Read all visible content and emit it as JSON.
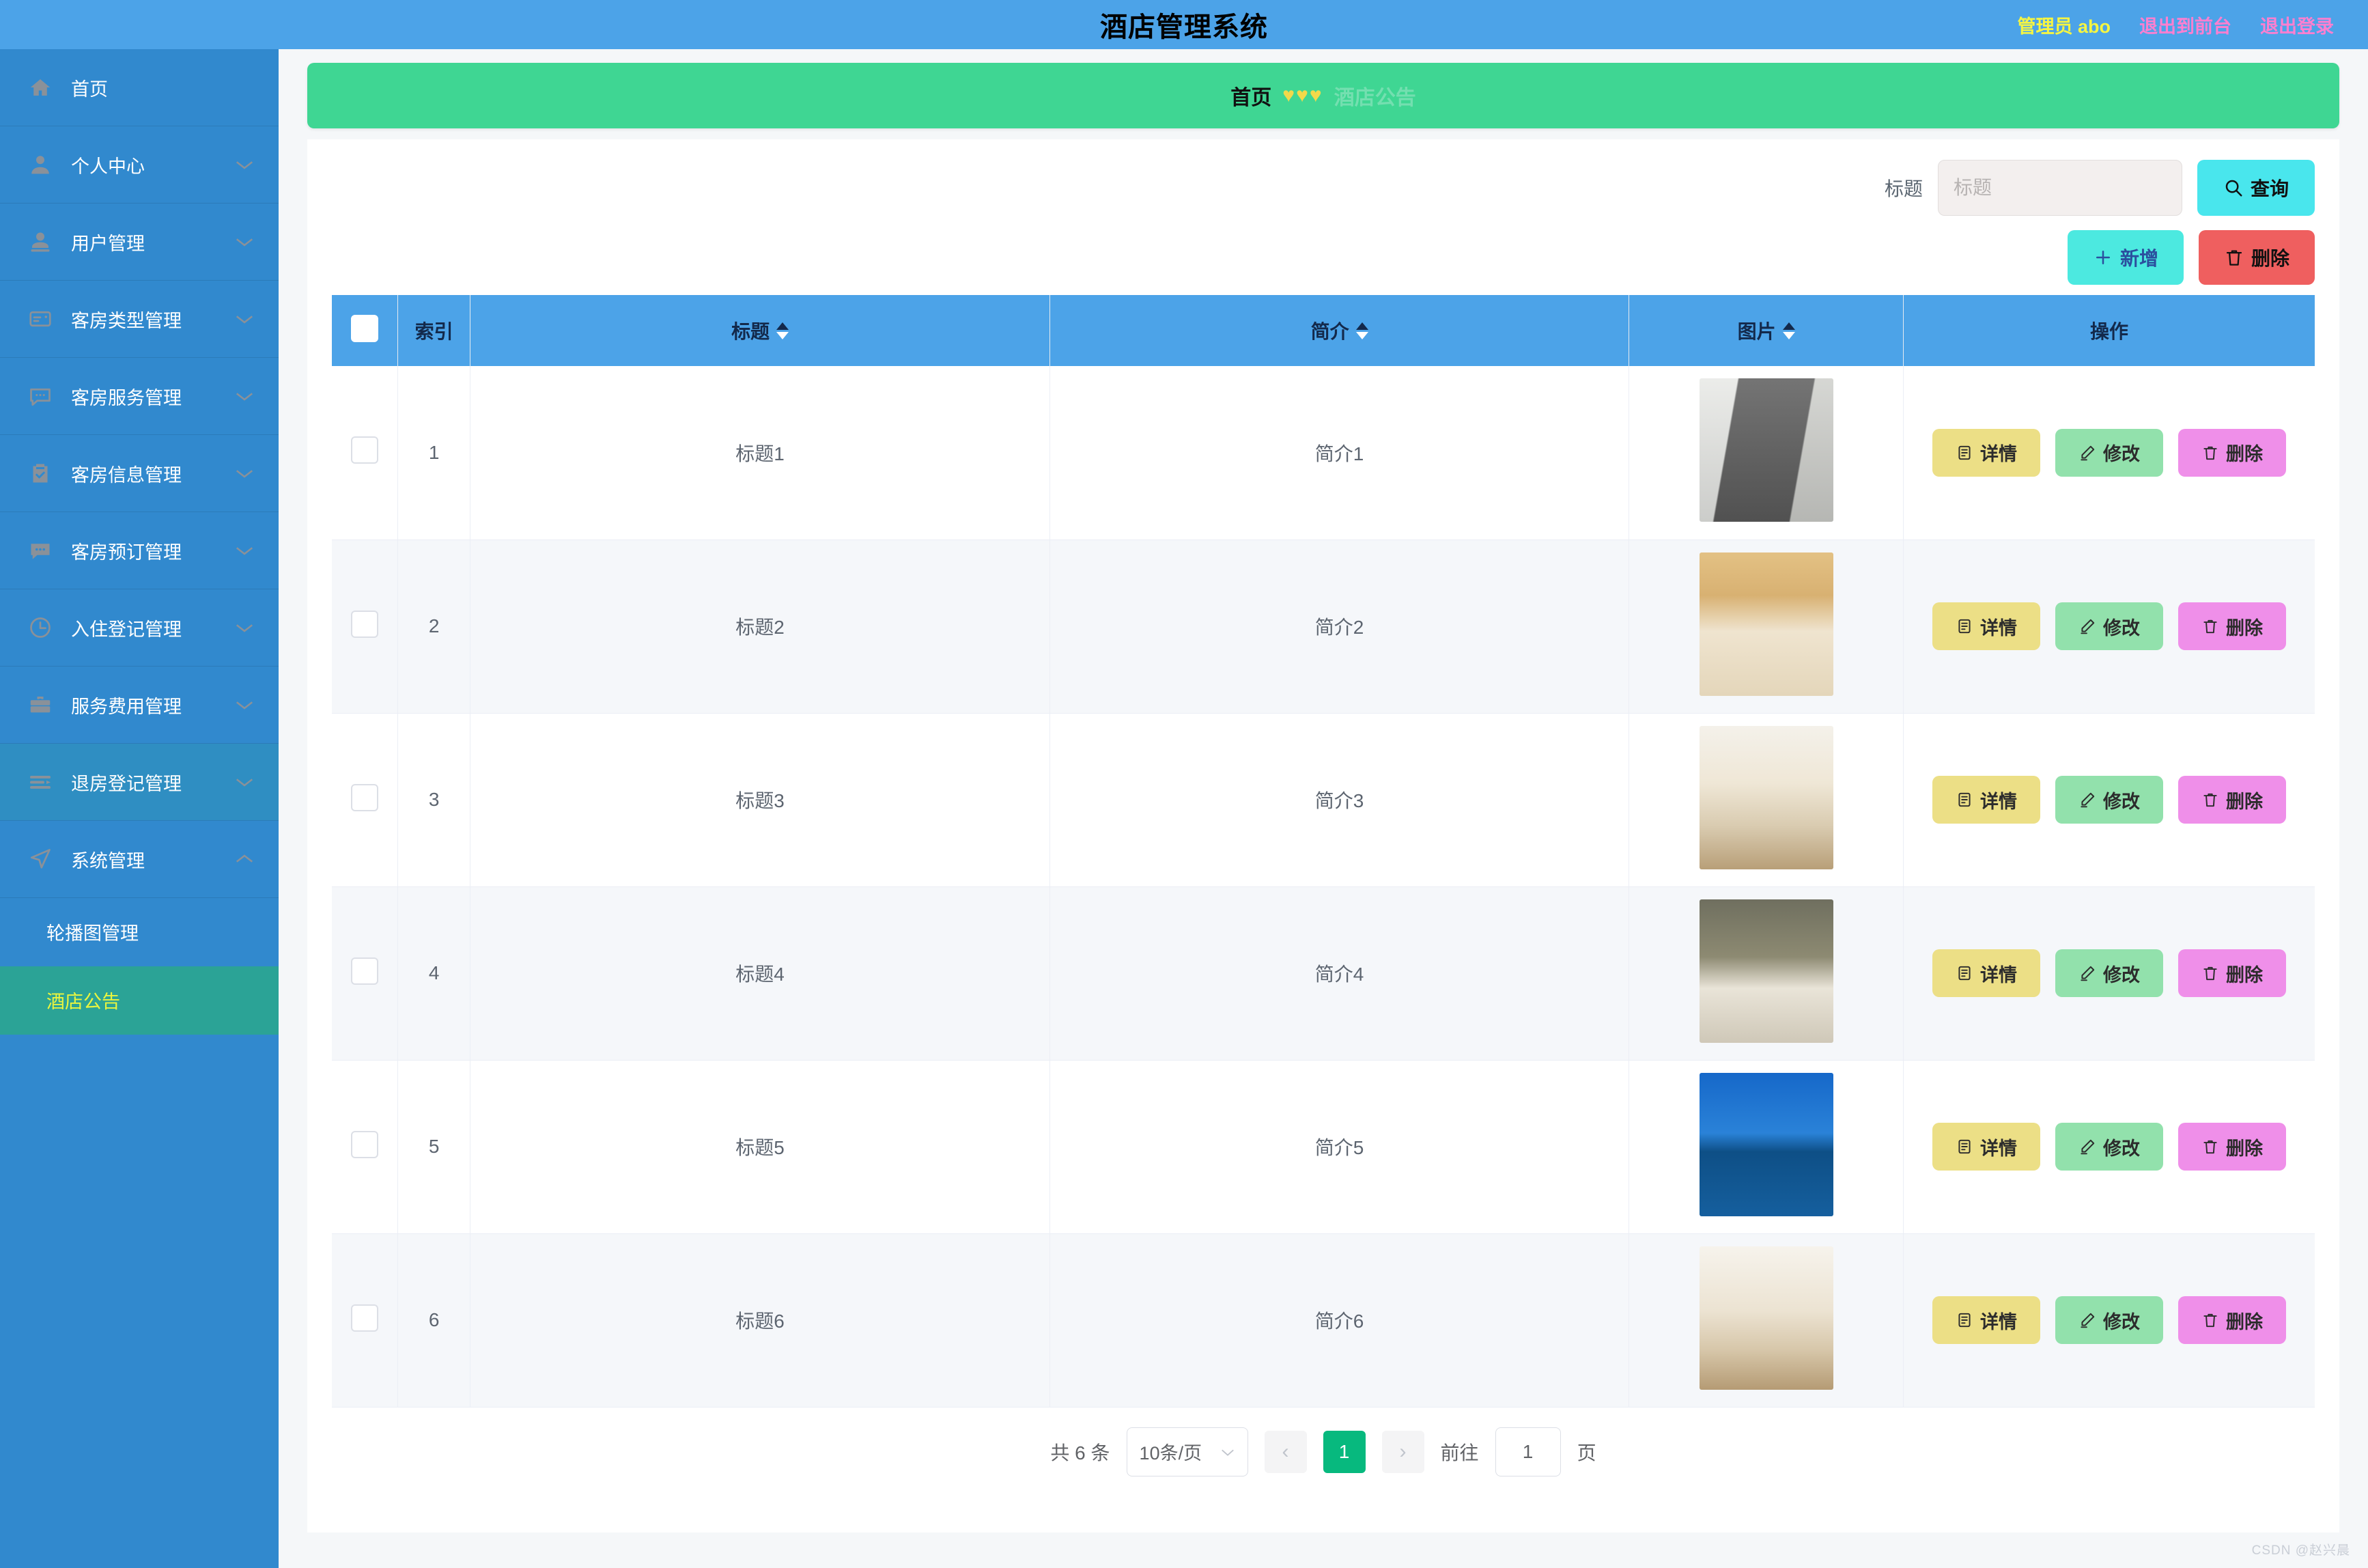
{
  "header": {
    "title": "酒店管理系统",
    "user_label": "管理员 abo",
    "logout_front_label": "退出到前台",
    "logout_label": "退出登录"
  },
  "breadcrumb": {
    "home": "首页",
    "separator": "♥♥♥",
    "current": "酒店公告"
  },
  "sidebar": {
    "items": [
      {
        "label": "首页",
        "icon": "home-icon",
        "has_arrow": false,
        "state": "normal"
      },
      {
        "label": "个人中心",
        "icon": "user-icon",
        "has_arrow": true,
        "state": "normal"
      },
      {
        "label": "用户管理",
        "icon": "user-solid-icon",
        "has_arrow": true,
        "state": "normal"
      },
      {
        "label": "客房类型管理",
        "icon": "postcard-icon",
        "has_arrow": true,
        "state": "normal"
      },
      {
        "label": "客房服务管理",
        "icon": "chat-icon",
        "has_arrow": true,
        "state": "normal"
      },
      {
        "label": "客房信息管理",
        "icon": "clipboard-check-icon",
        "has_arrow": true,
        "state": "normal"
      },
      {
        "label": "客房预订管理",
        "icon": "chat-solid-icon",
        "has_arrow": true,
        "state": "normal"
      },
      {
        "label": "入住登记管理",
        "icon": "clock-icon",
        "has_arrow": true,
        "state": "normal"
      },
      {
        "label": "服务费用管理",
        "icon": "suitcase-icon",
        "has_arrow": true,
        "state": "normal"
      },
      {
        "label": "退房登记管理",
        "icon": "list-arrow-icon",
        "has_arrow": true,
        "state": "hover"
      },
      {
        "label": "系统管理",
        "icon": "navigation-icon",
        "has_arrow": true,
        "state": "expanded"
      }
    ],
    "submenu": [
      {
        "label": "轮播图管理",
        "active": false
      },
      {
        "label": "酒店公告",
        "active": true
      }
    ]
  },
  "search": {
    "label": "标题",
    "placeholder": "标题",
    "value": "",
    "query_button": "查询"
  },
  "toolbar": {
    "add_label": "新增",
    "delete_label": "删除"
  },
  "table": {
    "columns": [
      {
        "key": "check",
        "label": "",
        "sortable": false
      },
      {
        "key": "index",
        "label": "索引",
        "sortable": false
      },
      {
        "key": "title",
        "label": "标题",
        "sortable": true
      },
      {
        "key": "intro",
        "label": "简介",
        "sortable": true
      },
      {
        "key": "image",
        "label": "图片",
        "sortable": true
      },
      {
        "key": "ops",
        "label": "操作",
        "sortable": false
      }
    ],
    "rows": [
      {
        "index": "1",
        "title": "标题1",
        "intro": "简介1",
        "image": "gray-bedroom-photo"
      },
      {
        "index": "2",
        "title": "标题2",
        "intro": "简介2",
        "image": "warm-twin-room-photo"
      },
      {
        "index": "3",
        "title": "标题3",
        "intro": "简介3",
        "image": "modern-bedroom-photo"
      },
      {
        "index": "4",
        "title": "标题4",
        "intro": "简介4",
        "image": "dark-twin-room-photo"
      },
      {
        "index": "5",
        "title": "标题5",
        "intro": "简介5",
        "image": "hotel-exterior-pool-photo"
      },
      {
        "index": "6",
        "title": "标题6",
        "intro": "简介6",
        "image": "bright-bedroom-photo"
      }
    ],
    "row_actions": {
      "detail_label": "详情",
      "edit_label": "修改",
      "delete_label": "删除"
    }
  },
  "pagination": {
    "total_text": "共 6 条",
    "page_size": "10条/页",
    "current_page": "1",
    "jump_prefix": "前往",
    "jump_value": "1",
    "jump_suffix": "页"
  },
  "watermark": "CSDN @赵兴晨",
  "colors": {
    "header_blue": "#4ca3e8",
    "sidebar_blue": "#3189ce",
    "active_teal": "#2ba396",
    "active_text_yellow": "#eaf53e",
    "breadcrumb_green": "#3fd693",
    "query_cyan": "#49e6ed",
    "delete_red": "#ef5f5f",
    "page_green": "#07b97e"
  }
}
